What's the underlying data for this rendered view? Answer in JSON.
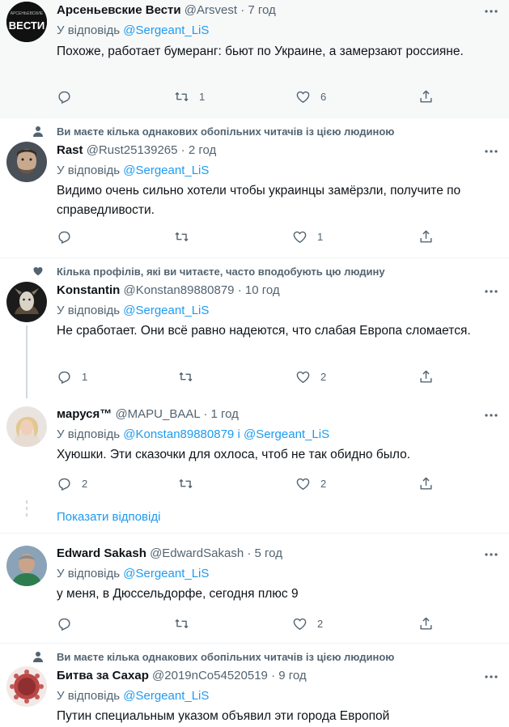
{
  "tweets": [
    {
      "name": "Арсеньевские Вести",
      "handle": "@Arsvest",
      "time": "7 год",
      "reply_prefix": "У відповідь",
      "reply_to": "@Sergeant_LiS",
      "text": "Похоже, работает бумеранг: бьют по Украине, а замерзают россияне.",
      "replies": "",
      "retweets": "1",
      "likes": "6",
      "avatar_text": "ВЕСТИ",
      "avatar_small": "АРСЕНЬЕВСКИЕ"
    },
    {
      "social": "Ви маєте кілька однакових обопільних читачів із цією людиною",
      "name": "Rast",
      "handle": "@Rust25139265",
      "time": "2 год",
      "reply_prefix": "У відповідь",
      "reply_to": "@Sergeant_LiS",
      "text": "Видимо очень сильно хотели чтобы украинцы замёрзли, получите по справедливости.",
      "replies": "",
      "retweets": "",
      "likes": "1"
    },
    {
      "social": "Кілька профілів, які ви читаєте, часто вподобують цю людину",
      "name": "Konstantin",
      "handle": "@Konstan89880879",
      "time": "10 год",
      "reply_prefix": "У відповідь",
      "reply_to": "@Sergeant_LiS",
      "text": "Не сработает. Они всё равно надеются, что слабая Европа сломается.",
      "replies": "1",
      "retweets": "",
      "likes": "2"
    },
    {
      "name": "маруся™",
      "handle": "@MAPU_BAAL",
      "time": "1 год",
      "reply_prefix": "У відповідь",
      "reply_to": "@Konstan89880879",
      "reply_and": "і",
      "reply_to2": "@Sergeant_LiS",
      "text": "Хуюшки. Эти сказочки для охлоса, чтоб не так обидно было.",
      "replies": "2",
      "retweets": "",
      "likes": "2"
    },
    {
      "name": "Edward Sakash",
      "handle": "@EdwardSakash",
      "time": "5 год",
      "reply_prefix": "У відповідь",
      "reply_to": "@Sergeant_LiS",
      "text": "у меня, в Дюссельдорфе, сегодня плюс 9",
      "replies": "",
      "retweets": "",
      "likes": "2"
    },
    {
      "social": "Ви маєте кілька однакових обопільних читачів із цією людиною",
      "name": "Битва за Сахар",
      "handle": "@2019nCo54520519",
      "time": "9 год",
      "reply_prefix": "У відповідь",
      "reply_to": "@Sergeant_LiS",
      "text": "Путин специальным указом объявил эти города Европой"
    }
  ],
  "show_replies": "Показати відповіді",
  "separator": "·",
  "colors": {
    "accent": "#1d9bf0",
    "muted": "#536471",
    "text": "#0f1419",
    "divider": "#eff3f4"
  },
  "icons": {
    "reply": "reply-icon",
    "retweet": "retweet-icon",
    "like": "heart-icon",
    "share": "share-icon",
    "more": "more-icon",
    "person": "person-icon",
    "heart_social": "heart-icon"
  }
}
